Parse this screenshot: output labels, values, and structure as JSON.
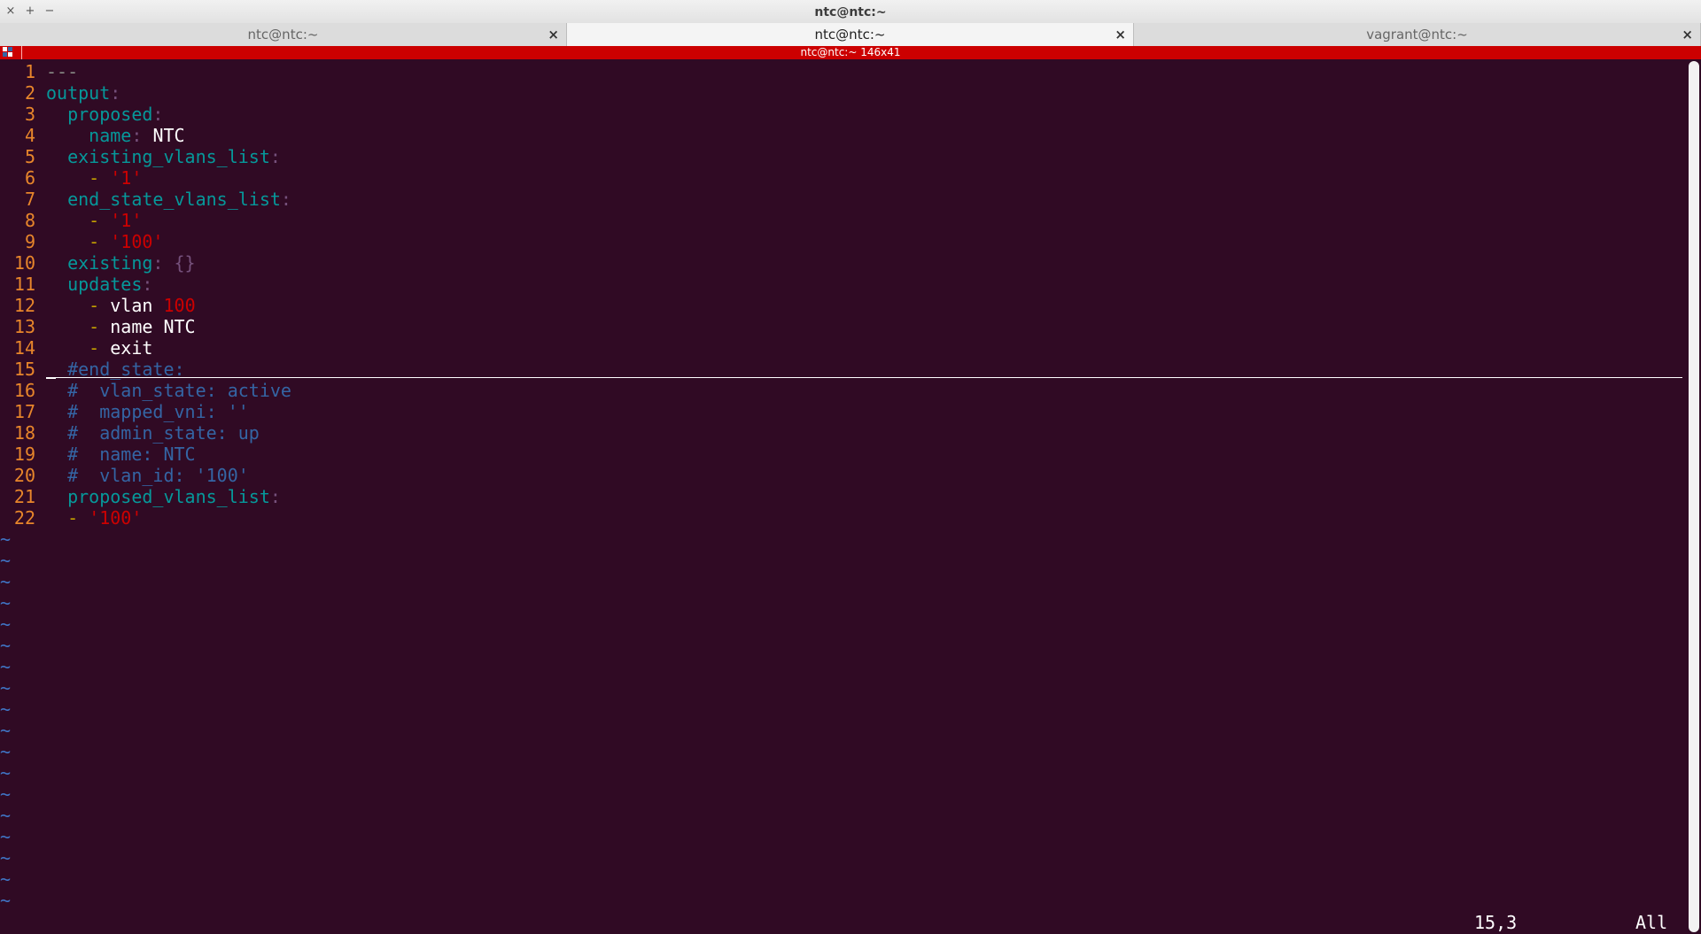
{
  "window": {
    "title": "ntc@ntc:~",
    "controls": [
      "×",
      "+",
      "−"
    ]
  },
  "tabs": [
    {
      "label": "ntc@ntc:~",
      "active": false
    },
    {
      "label": "ntc@ntc:~",
      "active": true
    },
    {
      "label": "vagrant@ntc:~",
      "active": false
    }
  ],
  "tab_close_glyph": "×",
  "terminal": {
    "label": "ntc@ntc:~ 146x41",
    "bar_color": "#cc0000"
  },
  "colors": {
    "background": "#300a24",
    "line_number": "#e8862b",
    "yaml_key": "#06989a",
    "string": "#cc0000",
    "comment": "#3465a4",
    "tilde": "#3f74c4"
  },
  "editor": {
    "lines": [
      {
        "n": "1",
        "tokens": [
          {
            "t": "---",
            "c": "doc"
          }
        ]
      },
      {
        "n": "2",
        "tokens": [
          {
            "t": "output",
            "c": "key"
          },
          {
            "t": ":",
            "c": "punc"
          }
        ]
      },
      {
        "n": "3",
        "tokens": [
          {
            "t": "  ",
            "c": "txt"
          },
          {
            "t": "proposed",
            "c": "key"
          },
          {
            "t": ":",
            "c": "punc"
          }
        ]
      },
      {
        "n": "4",
        "tokens": [
          {
            "t": "    ",
            "c": "txt"
          },
          {
            "t": "name",
            "c": "key"
          },
          {
            "t": ": ",
            "c": "punc"
          },
          {
            "t": "NTC",
            "c": "txt"
          }
        ]
      },
      {
        "n": "5",
        "tokens": [
          {
            "t": "  ",
            "c": "txt"
          },
          {
            "t": "existing_vlans_list",
            "c": "key"
          },
          {
            "t": ":",
            "c": "punc"
          }
        ]
      },
      {
        "n": "6",
        "tokens": [
          {
            "t": "    ",
            "c": "txt"
          },
          {
            "t": "- ",
            "c": "dash"
          },
          {
            "t": "'1'",
            "c": "str"
          }
        ]
      },
      {
        "n": "7",
        "tokens": [
          {
            "t": "  ",
            "c": "txt"
          },
          {
            "t": "end_state_vlans_list",
            "c": "key"
          },
          {
            "t": ":",
            "c": "punc"
          }
        ]
      },
      {
        "n": "8",
        "tokens": [
          {
            "t": "    ",
            "c": "txt"
          },
          {
            "t": "- ",
            "c": "dash"
          },
          {
            "t": "'1'",
            "c": "str"
          }
        ]
      },
      {
        "n": "9",
        "tokens": [
          {
            "t": "    ",
            "c": "txt"
          },
          {
            "t": "- ",
            "c": "dash"
          },
          {
            "t": "'100'",
            "c": "str"
          }
        ]
      },
      {
        "n": "10",
        "tokens": [
          {
            "t": "  ",
            "c": "txt"
          },
          {
            "t": "existing",
            "c": "key"
          },
          {
            "t": ": {}",
            "c": "punc"
          }
        ]
      },
      {
        "n": "11",
        "tokens": [
          {
            "t": "  ",
            "c": "txt"
          },
          {
            "t": "updates",
            "c": "key"
          },
          {
            "t": ":",
            "c": "punc"
          }
        ]
      },
      {
        "n": "12",
        "tokens": [
          {
            "t": "    ",
            "c": "txt"
          },
          {
            "t": "- ",
            "c": "dash"
          },
          {
            "t": "vlan ",
            "c": "txt"
          },
          {
            "t": "100",
            "c": "num"
          }
        ]
      },
      {
        "n": "13",
        "tokens": [
          {
            "t": "    ",
            "c": "txt"
          },
          {
            "t": "- ",
            "c": "dash"
          },
          {
            "t": "name NTC",
            "c": "txt"
          }
        ]
      },
      {
        "n": "14",
        "tokens": [
          {
            "t": "    ",
            "c": "txt"
          },
          {
            "t": "- ",
            "c": "dash"
          },
          {
            "t": "exit",
            "c": "txt"
          }
        ]
      },
      {
        "n": "15",
        "tokens": [
          {
            "t": "  ",
            "c": "txt"
          },
          {
            "t": "#end_state:",
            "c": "cmt"
          }
        ]
      },
      {
        "n": "16",
        "tokens": [
          {
            "t": "  ",
            "c": "txt"
          },
          {
            "t": "#  vlan_state: active",
            "c": "cmt"
          }
        ]
      },
      {
        "n": "17",
        "tokens": [
          {
            "t": "  ",
            "c": "txt"
          },
          {
            "t": "#  mapped_vni: ''",
            "c": "cmt"
          }
        ]
      },
      {
        "n": "18",
        "tokens": [
          {
            "t": "  ",
            "c": "txt"
          },
          {
            "t": "#  admin_state: up",
            "c": "cmt"
          }
        ]
      },
      {
        "n": "19",
        "tokens": [
          {
            "t": "  ",
            "c": "txt"
          },
          {
            "t": "#  name: NTC",
            "c": "cmt"
          }
        ]
      },
      {
        "n": "20",
        "tokens": [
          {
            "t": "  ",
            "c": "txt"
          },
          {
            "t": "#  vlan_id: '100'",
            "c": "cmt"
          }
        ]
      },
      {
        "n": "21",
        "tokens": [
          {
            "t": "  ",
            "c": "txt"
          },
          {
            "t": "proposed_vlans_list",
            "c": "key"
          },
          {
            "t": ":",
            "c": "punc"
          }
        ]
      },
      {
        "n": "22",
        "tokens": [
          {
            "t": "  ",
            "c": "txt"
          },
          {
            "t": "- ",
            "c": "dash"
          },
          {
            "t": "'100'",
            "c": "str"
          }
        ]
      }
    ],
    "cursor_line": 15,
    "empty_line_marker": "~",
    "empty_line_count": 18
  },
  "status": {
    "position": "15,3",
    "scroll": "All"
  }
}
